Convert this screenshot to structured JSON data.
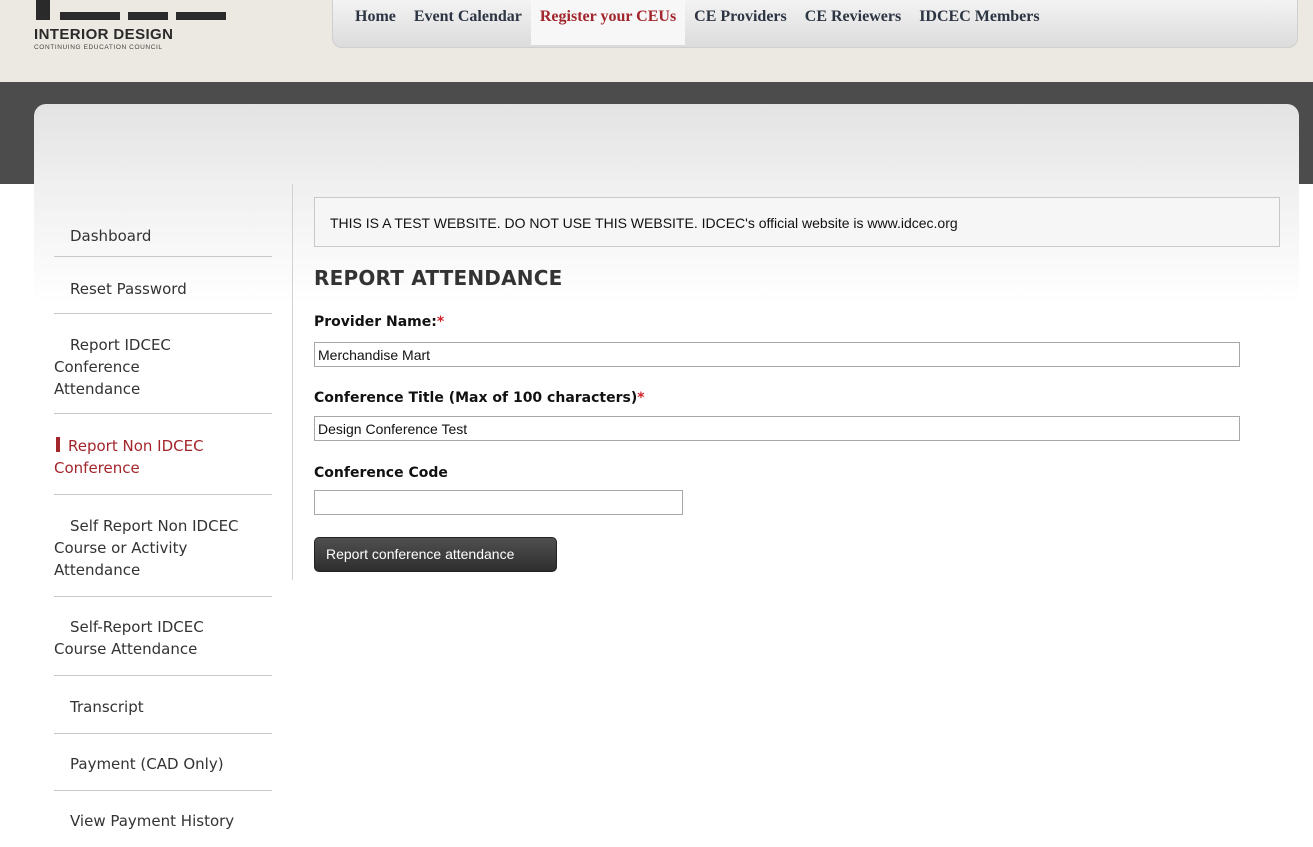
{
  "brand": {
    "name": "INTERIOR DESIGN",
    "tagline": "CONTINUING EDUCATION COUNCIL"
  },
  "nav": {
    "items": [
      "Home",
      "Event Calendar",
      "Register your CEUs",
      "CE Providers",
      "CE Reviewers",
      "IDCEC Members"
    ],
    "active": "Register your CEUs"
  },
  "sidebar": {
    "items": [
      "Dashboard",
      "Reset Password",
      "Report IDCEC Conference Attendance",
      "Report Non IDCEC Conference",
      "Self Report Non IDCEC Course or Activity Attendance",
      "Self-Report IDCEC Course Attendance",
      "Transcript",
      "Payment (CAD Only)",
      "View Payment History"
    ],
    "active": "Report Non IDCEC Conference"
  },
  "notice": "THIS IS A TEST WEBSITE. DO NOT USE THIS WEBSITE. IDCEC's official website is www.idcec.org",
  "page_title": "REPORT ATTENDANCE",
  "form": {
    "provider_label": "Provider Name:",
    "provider_value": "Merchandise Mart",
    "title_label": "Conference Title (Max of 100 characters)",
    "title_value": "Design Conference Test",
    "code_label": "Conference Code",
    "code_value": "",
    "required_mark": "*",
    "submit_label": "Report conference attendance"
  },
  "colors": {
    "accent": "#a2262b",
    "required": "#d2232a",
    "dark_band": "#4c4c4c"
  }
}
